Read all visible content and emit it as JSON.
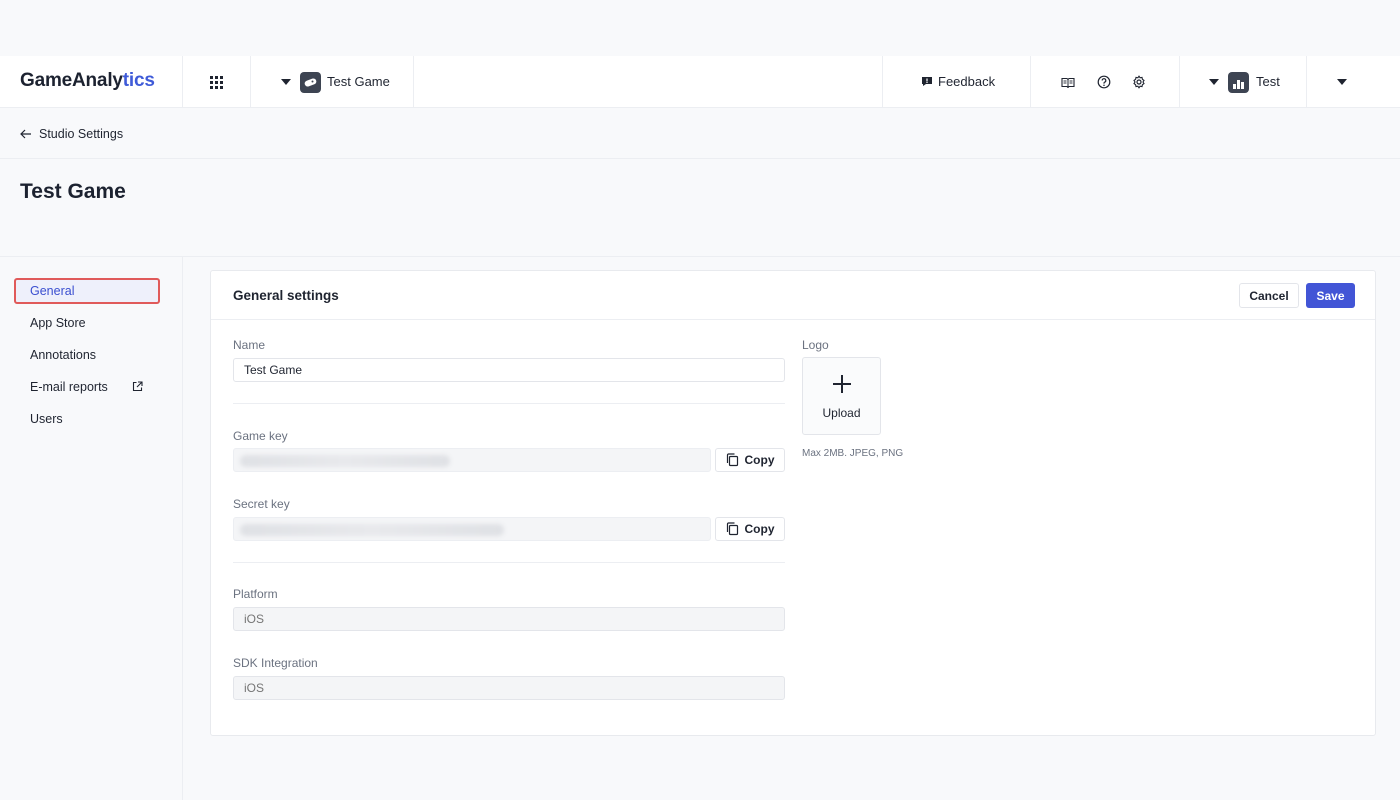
{
  "header": {
    "brand_part1": "GameAna",
    "brand_part2": "ly",
    "brand_part3": "tics",
    "game_name": "Test Game",
    "feedback_label": "Feedback",
    "studio_name": "Test"
  },
  "breadcrumb": {
    "back_label": "Studio Settings"
  },
  "page": {
    "title": "Test Game"
  },
  "sidebar": {
    "items": [
      {
        "label": "General",
        "active": true
      },
      {
        "label": "App Store"
      },
      {
        "label": "Annotations"
      },
      {
        "label": "E-mail reports",
        "external": true
      },
      {
        "label": "Users"
      }
    ]
  },
  "panel": {
    "title": "General settings",
    "cancel_label": "Cancel",
    "save_label": "Save",
    "name_label": "Name",
    "name_value": "Test Game",
    "game_key_label": "Game key",
    "secret_key_label": "Secret key",
    "copy_label": "Copy",
    "platform_label": "Platform",
    "platform_placeholder": "iOS",
    "sdk_label": "SDK Integration",
    "sdk_placeholder": "iOS",
    "logo_label": "Logo",
    "upload_label": "Upload",
    "logo_hint": "Max 2MB. JPEG, PNG"
  },
  "colors": {
    "accent": "#4255d6",
    "active_nav_text": "#3b4fd0",
    "highlight_border": "#e05a5a"
  }
}
